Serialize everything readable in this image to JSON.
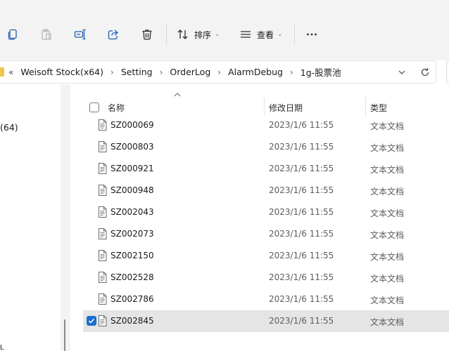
{
  "toolbar": {
    "sort_label": "排序",
    "view_label": "查看",
    "icons": [
      "copy-icon",
      "paste-icon",
      "rename-icon",
      "share-icon",
      "delete-icon",
      "sort-icon",
      "view-icon",
      "more-icon"
    ]
  },
  "address": {
    "lead": "«",
    "crumbs": [
      "Weisoft Stock(x64)",
      "Setting",
      "OrderLog",
      "AlarmDebug",
      "1g-股票池"
    ],
    "separator": "›"
  },
  "nav": {
    "partial_label": "(64)",
    "bottom_label": "L"
  },
  "columns": {
    "name": "名称",
    "date": "修改日期",
    "type": "类型"
  },
  "files": [
    {
      "name": "SZ000069",
      "date": "2023/1/6 11:55",
      "type": "文本文档",
      "selected": false
    },
    {
      "name": "SZ000803",
      "date": "2023/1/6 11:55",
      "type": "文本文档",
      "selected": false
    },
    {
      "name": "SZ000921",
      "date": "2023/1/6 11:55",
      "type": "文本文档",
      "selected": false
    },
    {
      "name": "SZ000948",
      "date": "2023/1/6 11:55",
      "type": "文本文档",
      "selected": false
    },
    {
      "name": "SZ002043",
      "date": "2023/1/6 11:55",
      "type": "文本文档",
      "selected": false
    },
    {
      "name": "SZ002073",
      "date": "2023/1/6 11:55",
      "type": "文本文档",
      "selected": false
    },
    {
      "name": "SZ002150",
      "date": "2023/1/6 11:55",
      "type": "文本文档",
      "selected": false
    },
    {
      "name": "SZ002528",
      "date": "2023/1/6 11:55",
      "type": "文本文档",
      "selected": false
    },
    {
      "name": "SZ002786",
      "date": "2023/1/6 11:55",
      "type": "文本文档",
      "selected": false
    },
    {
      "name": "SZ002845",
      "date": "2023/1/6 11:55",
      "type": "文本文档",
      "selected": true
    }
  ],
  "colors": {
    "accent": "#1a6fd0",
    "selected_row": "#e5e5e5",
    "toolbar_bg": "#f3f3f3",
    "folder": "#f0c64a"
  }
}
